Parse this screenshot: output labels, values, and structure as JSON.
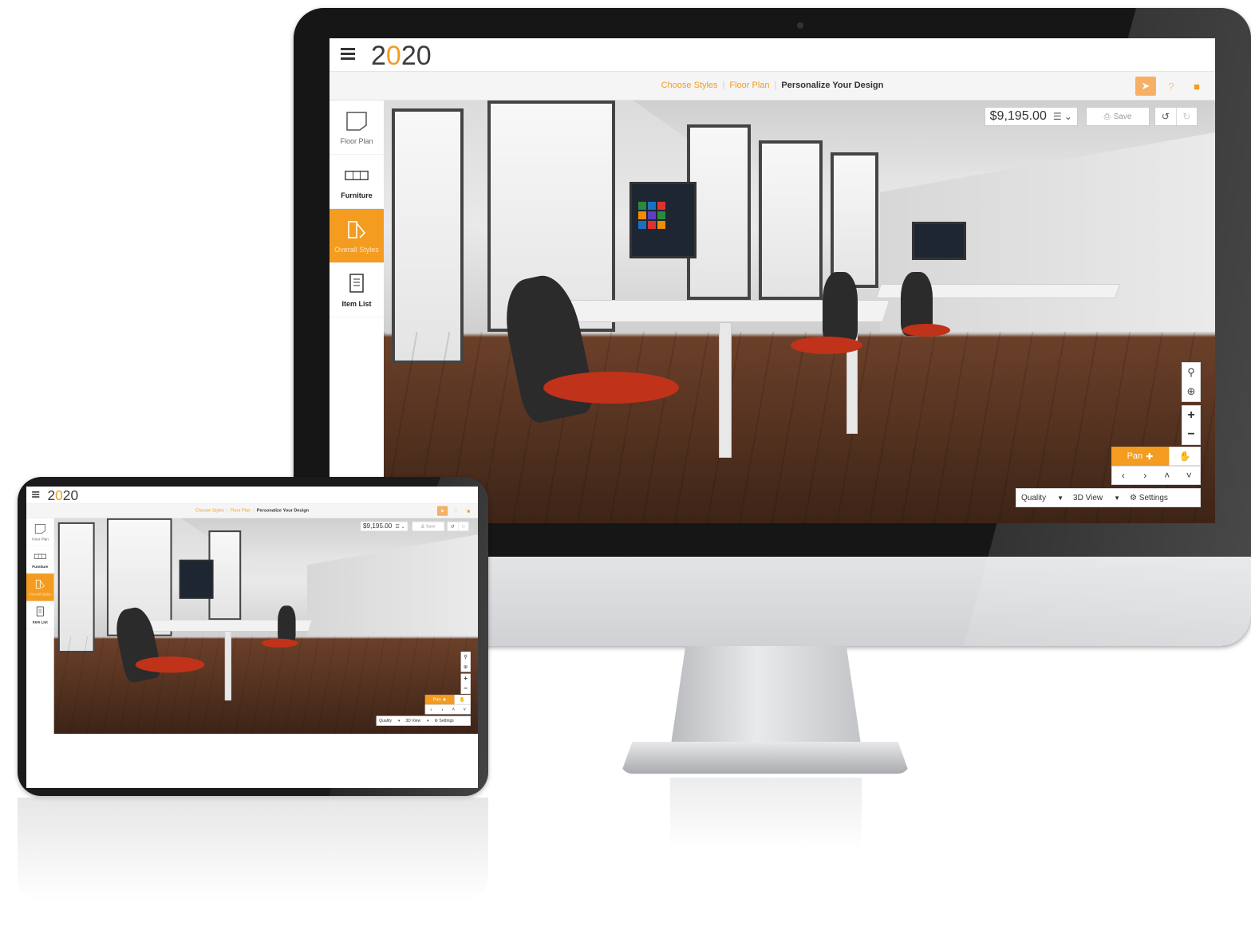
{
  "app": {
    "logo_prefix": "2",
    "logo_o": "0",
    "logo_suffix": "20"
  },
  "steps": {
    "items": [
      {
        "label": "Choose Styles"
      },
      {
        "label": "Floor Plan"
      },
      {
        "label": "Personalize Your Design"
      }
    ],
    "current_index": 2
  },
  "top_icons": [
    "paper-plane-icon",
    "help-icon",
    "video-camera-icon"
  ],
  "sidebar": {
    "items": [
      {
        "label": "Floor Plan",
        "icon": "floor-plan-icon"
      },
      {
        "label": "Furniture",
        "icon": "furniture-icon"
      },
      {
        "label": "Overall Styles",
        "icon": "swatch-icon",
        "active": true
      },
      {
        "label": "Item List",
        "icon": "list-document-icon"
      }
    ]
  },
  "toolbar": {
    "price": "$9,195.00",
    "save_label": "Save"
  },
  "controls": {
    "pan_label": "Pan",
    "quality_label": "Quality",
    "view_label": "3D View",
    "settings_label": "Settings"
  },
  "colors": {
    "accent": "#f39c1f",
    "chair_seat": "#c0321a"
  }
}
